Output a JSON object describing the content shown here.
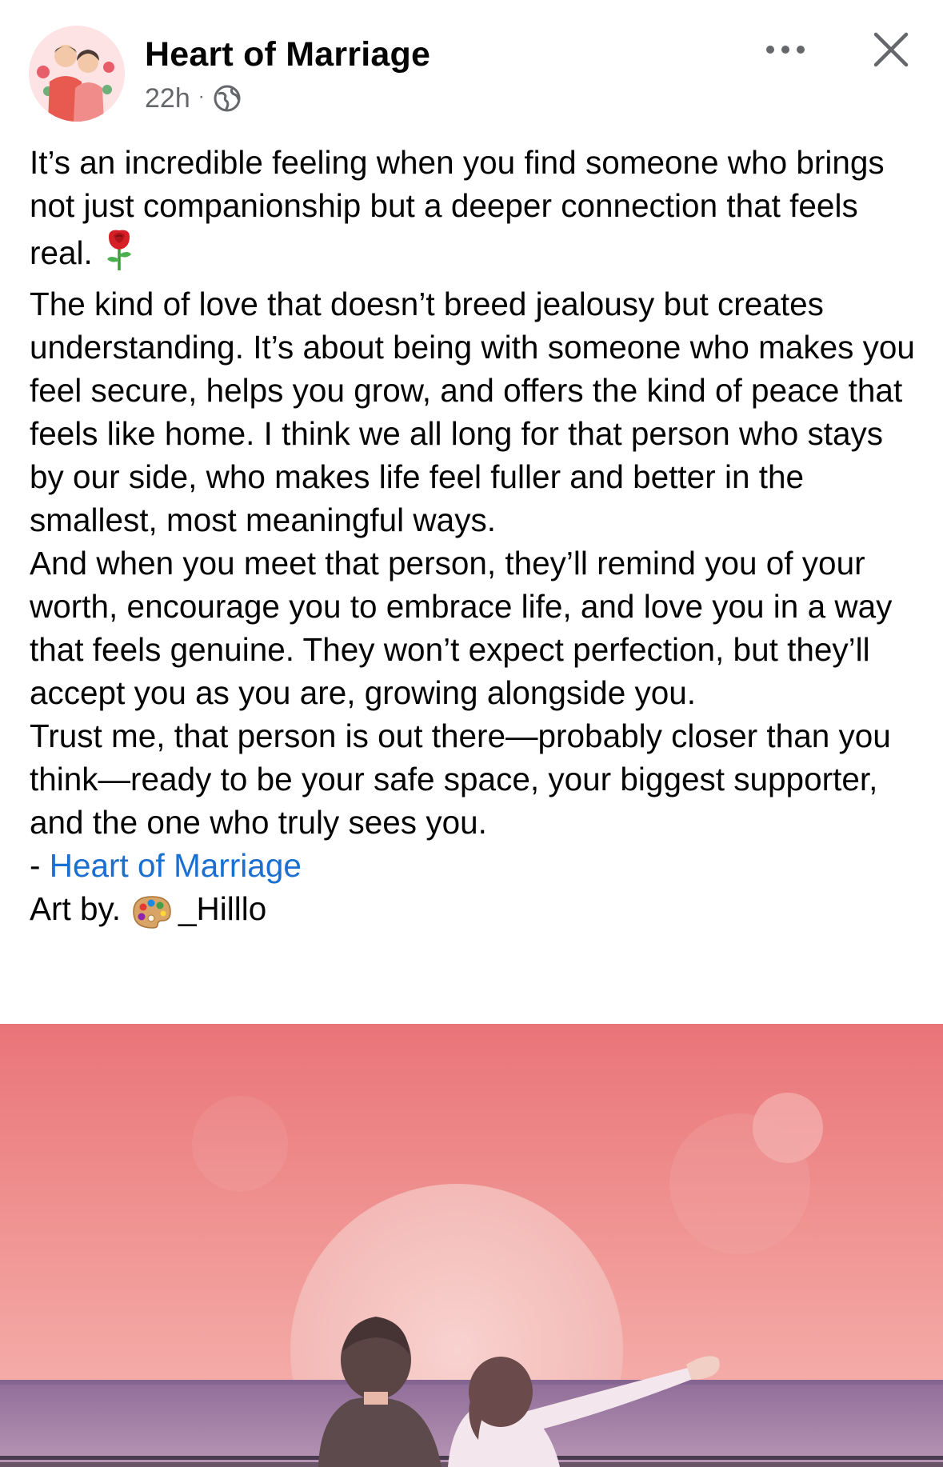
{
  "post": {
    "author": "Heart of Marriage",
    "timestamp": "22h",
    "separator": "·",
    "audience_icon": "globe-icon",
    "more_icon": "more-horizontal-icon",
    "close_icon": "close-icon"
  },
  "content": {
    "paragraph_1": "It’s an incredible feeling when you find someone who brings not just companionship but a deeper connection that feels real.",
    "rose_emoji": "rose-emoji",
    "paragraph_2": "The kind of love that doesn’t breed jealousy but creates understanding. It’s about being with someone who makes you feel secure, helps you grow, and offers the kind of peace that feels like home. I think we all long for that person who stays by our side, who makes life feel fuller and better in the smallest, most meaningful ways.",
    "paragraph_3": "And when you meet that person, they’ll remind you of your worth, encourage you to embrace life, and love you in a way that feels genuine. They won’t expect perfection, but they’ll accept you as you are, growing alongside you.",
    "paragraph_4": "Trust me, that person is out there—probably closer than you think—ready to be your safe space, your biggest supporter, and the one who truly sees you.",
    "signature_prefix": "- ",
    "signature_link": "Heart of Marriage",
    "art_prefix": "Art by.",
    "palette_emoji": "artist-palette-emoji",
    "art_credit": "_Hilllo"
  },
  "colors": {
    "text": "#050505",
    "meta": "#65676b",
    "link": "#1a6fd1",
    "sky_top": "#e97a7c",
    "sky_bottom": "#f4b0ad",
    "sun": "#f7c9c8",
    "sea": "#9d7aa0"
  }
}
